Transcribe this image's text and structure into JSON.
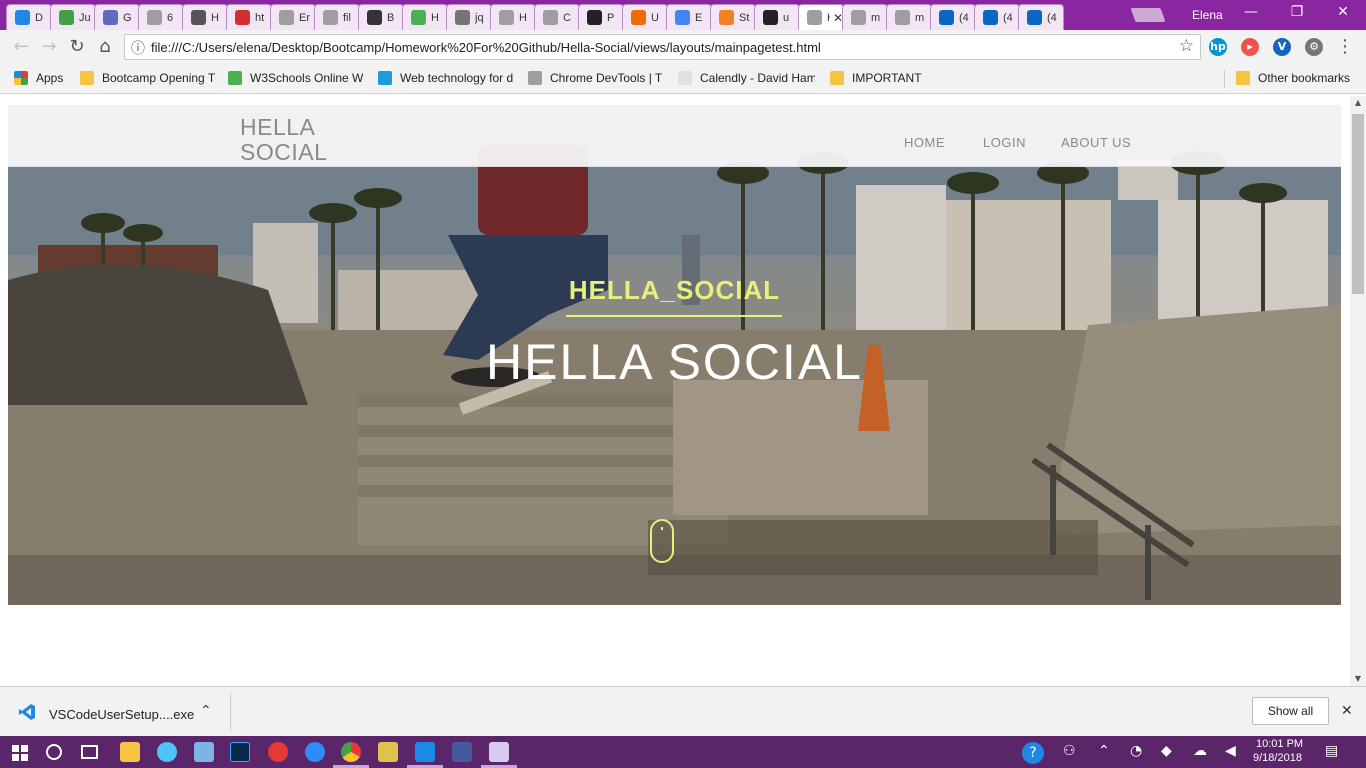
{
  "browser": {
    "tabs": [
      {
        "title": "D",
        "icon": "vscode-icon",
        "color": "#1e88e5"
      },
      {
        "title": "Ju",
        "icon": "jupyter-icon",
        "color": "#43a047"
      },
      {
        "title": "G",
        "icon": "globe-icon",
        "color": "#5c6bc0"
      },
      {
        "title": "6",
        "icon": "page-icon",
        "color": "#9e9e9e"
      },
      {
        "title": "H",
        "icon": "wave-icon",
        "color": "#555555"
      },
      {
        "title": "ht",
        "icon": "brand-icon",
        "color": "#d32f2f"
      },
      {
        "title": "Er",
        "icon": "page-icon",
        "color": "#9e9e9e"
      },
      {
        "title": "fil",
        "icon": "page-icon",
        "color": "#9e9e9e"
      },
      {
        "title": "B",
        "icon": "codepen-icon",
        "color": "#333333"
      },
      {
        "title": "H",
        "icon": "w3schools-icon",
        "color": "#4caf50"
      },
      {
        "title": "jq",
        "icon": "c-icon",
        "color": "#757575"
      },
      {
        "title": "H",
        "icon": "page-icon",
        "color": "#9e9e9e"
      },
      {
        "title": "C",
        "icon": "devtools-icon",
        "color": "#9e9e9e"
      },
      {
        "title": "P",
        "icon": "github-icon",
        "color": "#222222"
      },
      {
        "title": "U",
        "icon": "asterisk-icon",
        "color": "#ef6c00"
      },
      {
        "title": "E",
        "icon": "google-icon",
        "color": "#4285f4"
      },
      {
        "title": "St",
        "icon": "stackoverflow-icon",
        "color": "#f48024"
      },
      {
        "title": "u",
        "icon": "github-icon",
        "color": "#222222"
      },
      {
        "title": "H",
        "icon": "page-icon",
        "color": "#9e9e9e",
        "active": true,
        "close": "✕"
      },
      {
        "title": "m",
        "icon": "page-icon",
        "color": "#9e9e9e"
      },
      {
        "title": "m",
        "icon": "page-icon",
        "color": "#9e9e9e"
      },
      {
        "title": "(4",
        "icon": "linkedin-icon",
        "color": "#0a66c2"
      },
      {
        "title": "(4",
        "icon": "linkedin-icon",
        "color": "#0a66c2"
      },
      {
        "title": "(4",
        "icon": "linkedin-icon",
        "color": "#0a66c2"
      }
    ],
    "profile_name": "Elena",
    "window_controls": {
      "minimize": "—",
      "restore": "❐",
      "close": "✕"
    },
    "nav": {
      "back": "←",
      "forward": "→",
      "reload": "↻",
      "home": "⌂"
    },
    "url": "file:///C:/Users/elena/Desktop/Bootcamp/Homework%20For%20Github/Hella-Social/views/layouts/mainpagetest.html",
    "info_icon": "ⓘ",
    "star": "☆",
    "extensions": [
      {
        "name": "hp-icon",
        "label": "hp",
        "color": "#0096d6"
      },
      {
        "name": "arrow-extension-icon",
        "label": "▸",
        "color": "#ef5350"
      },
      {
        "name": "v-extension-icon",
        "label": "V",
        "color": "#1565c0"
      },
      {
        "name": "settings-extension-icon",
        "label": "⚙",
        "color": "#777777"
      }
    ],
    "menu": "⋮"
  },
  "bookmarks": {
    "apps_label": "Apps",
    "items": [
      {
        "label": "Bootcamp Opening T",
        "icon": "folder-icon"
      },
      {
        "label": "W3Schools Online W",
        "icon": "w3schools-icon"
      },
      {
        "label": "Web technology for d",
        "icon": "mdn-icon"
      },
      {
        "label": "Chrome DevTools  |  T",
        "icon": "devtools-icon"
      },
      {
        "label": "Calendly - David Ham",
        "icon": "calendly-icon"
      },
      {
        "label": "IMPORTANT",
        "icon": "folder-icon"
      }
    ],
    "other_label": "Other bookmarks"
  },
  "page": {
    "logo_line1": "HELLA",
    "logo_line2": "SOCIAL",
    "nav": [
      "HOME",
      "LOGIN",
      "ABOUT US"
    ],
    "hero_subtitle": "HELLA_SOCIAL",
    "hero_title": "HELLA SOCIAL",
    "accent_color": "#e8ef7a"
  },
  "downloads": {
    "file_name": "VSCodeUserSetup....exe",
    "expand": "⌃",
    "show_all": "Show all",
    "close": "✕"
  },
  "taskbar": {
    "time": "10:01 PM",
    "date": "9/18/2018"
  }
}
